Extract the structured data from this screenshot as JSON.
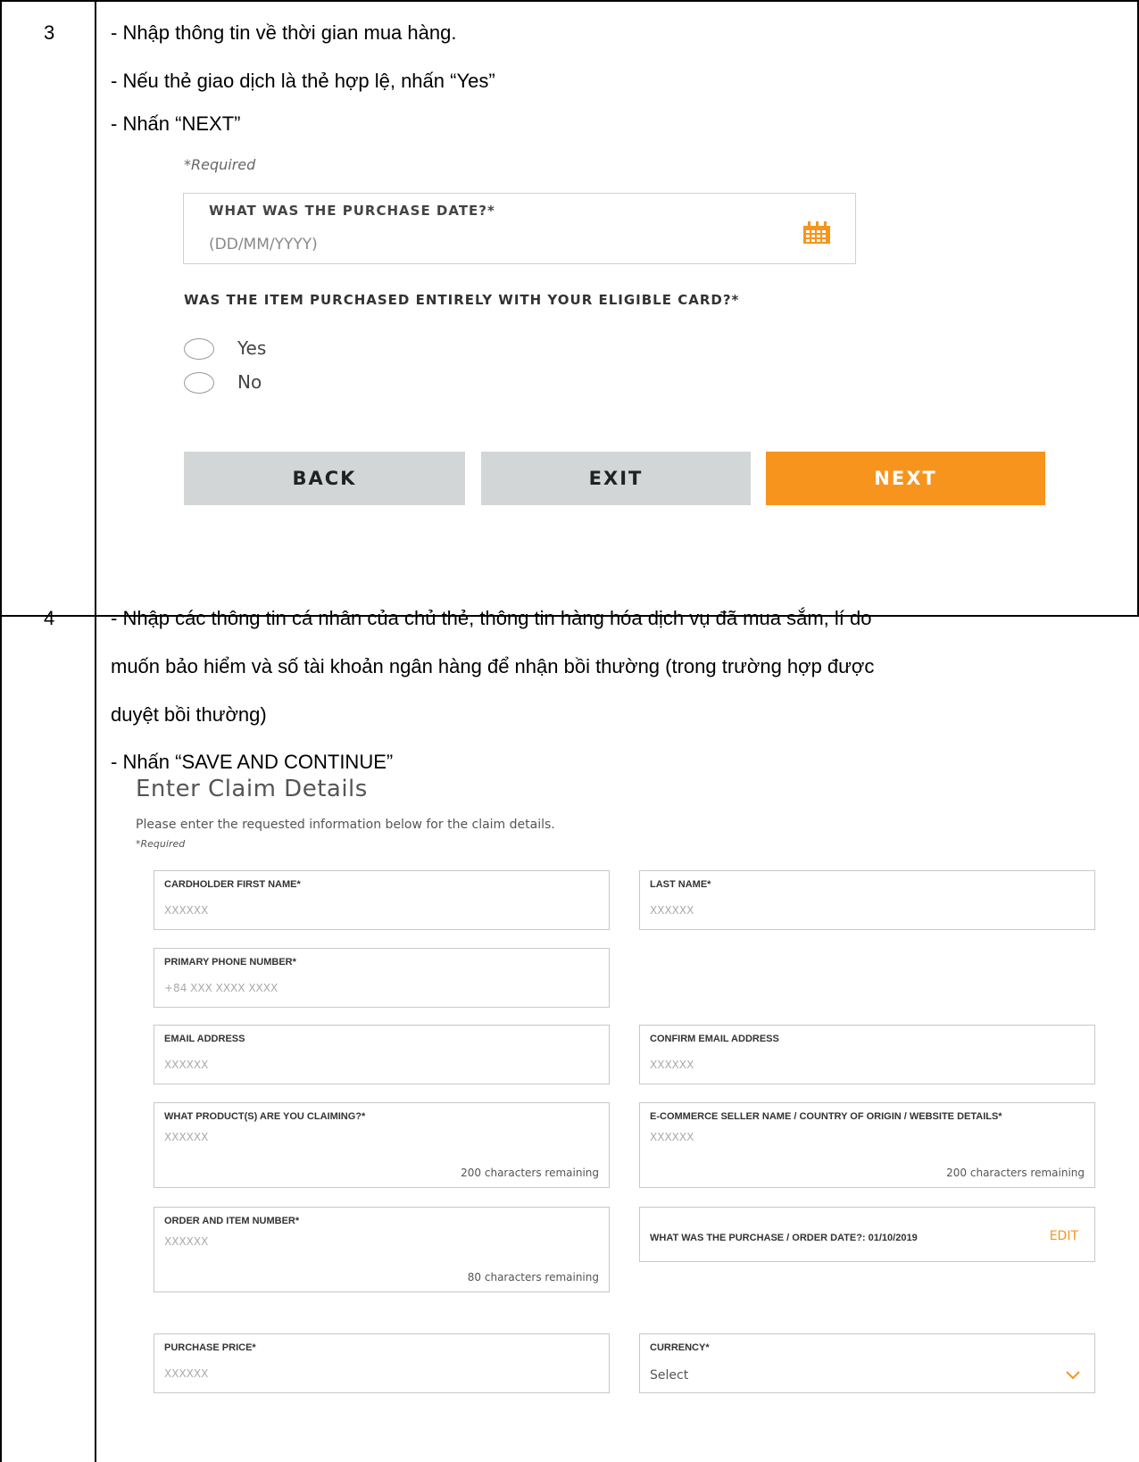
{
  "rows": [
    {
      "number": "3",
      "instructions": [
        "- Nhập thông tin về thời gian mua hàng.",
        "- Nếu thẻ giao dịch là thẻ hợp lệ, nhấn “Yes”",
        "- Nhấn “NEXT”"
      ],
      "form": {
        "required_note": "*Required",
        "purchase_date": {
          "label": "WHAT WAS THE PURCHASE DATE?*",
          "placeholder": "(DD/MM/YYYY)",
          "icon": "calendar-icon"
        },
        "question": "WAS THE ITEM PURCHASED ENTIRELY WITH YOUR ELIGIBLE CARD?*",
        "options": [
          "Yes",
          "No"
        ],
        "buttons": {
          "back": "BACK",
          "exit": "EXIT",
          "next": "NEXT"
        }
      }
    },
    {
      "number": "4",
      "instructions": [
        "- Nhập các thông tin cá nhân của chủ thẻ, thông tin hàng hóa dịch vụ đã mua sắm, lí do",
        "muốn bảo hiểm và số tài khoản ngân hàng để nhận bồi thường (trong trường hợp được",
        "duyệt bồi thường)",
        "- Nhấn “SAVE AND CONTINUE”"
      ],
      "form": {
        "title": "Enter Claim Details",
        "subtitle": "Please enter the requested information below for the claim details.",
        "required_note": "*Required",
        "fields": {
          "first_name": {
            "label": "CARDHOLDER FIRST NAME*",
            "value": "XXXXXX"
          },
          "last_name": {
            "label": "LAST NAME*",
            "value": "XXXXXX"
          },
          "phone": {
            "label": "PRIMARY PHONE NUMBER*",
            "value": "+84 XXX XXXX XXXX"
          },
          "email": {
            "label": "EMAIL ADDRESS",
            "value": "XXXXXX"
          },
          "confirm_email": {
            "label": "CONFIRM EMAIL ADDRESS",
            "value": "XXXXXX"
          },
          "products": {
            "label": "WHAT PRODUCT(S) ARE YOU CLAIMING?*",
            "value": "XXXXXX",
            "remaining": "200 characters remaining"
          },
          "seller": {
            "label": "E-COMMERCE SELLER NAME / COUNTRY OF ORIGIN / WEBSITE DETAILS*",
            "value": "XXXXXX",
            "remaining": "200 characters remaining"
          },
          "order_number": {
            "label": "ORDER AND ITEM NUMBER*",
            "value": "XXXXXX",
            "remaining": "80 characters remaining"
          },
          "purchase_date": {
            "text": "WHAT WAS THE PURCHASE / ORDER DATE?: 01/10/2019",
            "action": "EDIT"
          },
          "price": {
            "label": "PURCHASE PRICE*",
            "value": "XXXXXX"
          },
          "currency": {
            "label": "CURRENCY*",
            "value": "Select",
            "icon": "chevron-down-icon"
          }
        }
      }
    }
  ],
  "colors": {
    "accent": "#f7941d",
    "button_grey": "#d3d6d6",
    "field_border": "#c8c8c8"
  }
}
